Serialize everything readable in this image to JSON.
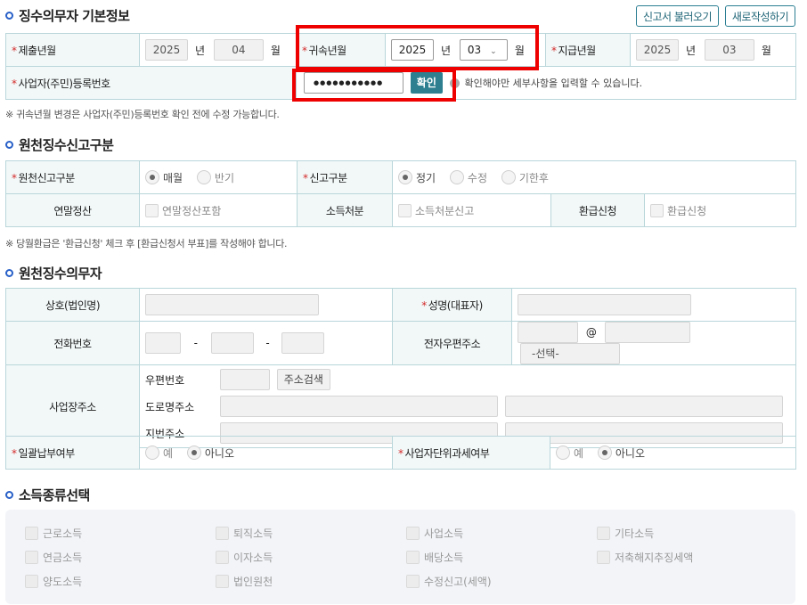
{
  "header": {
    "title": "징수의무자 기본정보",
    "btn_load": "신고서 불러오기",
    "btn_new": "새로작성하기"
  },
  "basic": {
    "submit_label": "제출년월",
    "submit_year": "2025",
    "submit_month": "04",
    "attribution_label": "귀속년월",
    "attribution_year": "2025",
    "attribution_month": "03",
    "payment_label": "지급년월",
    "payment_year": "2025",
    "payment_month": "03",
    "unit_year": "년",
    "unit_month": "월",
    "reg_no_label": "사업자(주민)등록번호",
    "reg_no_value": "●●●●●●●●●●●",
    "confirm_btn": "확인",
    "confirm_hint": "확인해야만 세부사항을 입력할 수 있습니다.",
    "note": "※ 귀속년월 변경은 사업자(주민)등록번호 확인 전에 수정 가능합니다."
  },
  "report_type": {
    "title": "원천징수신고구분",
    "withholding_label": "원천신고구분",
    "opt_monthly": "매월",
    "opt_half": "반기",
    "report_label": "신고구분",
    "opt_regular": "정기",
    "opt_amend": "수정",
    "opt_late": "기한후",
    "year_end_label": "연말정산",
    "year_end_chk": "연말정산포함",
    "disposal_label": "소득처분",
    "disposal_chk": "소득처분신고",
    "refund_label": "환급신청",
    "refund_chk": "환급신청",
    "note": "※ 당월환급은 '환급신청' 체크 후 [환급신청서 부표]를 작성해야 합니다."
  },
  "agent": {
    "title": "원천징수의무자",
    "company_label": "상호(법인명)",
    "ceo_label": "성명(대표자)",
    "phone_label": "전화번호",
    "email_label": "전자우편주소",
    "email_at": "@",
    "email_select": "-선택-",
    "dash": "-",
    "addr_label": "사업장주소",
    "zip_label": "우편번호",
    "zip_btn": "주소검색",
    "road_label": "도로명주소",
    "lot_label": "지번주소",
    "lump_label": "일괄납부여부",
    "unit_tax_label": "사업자단위과세여부",
    "opt_yes": "예",
    "opt_no": "아니오"
  },
  "income": {
    "title": "소득종류선택",
    "items": [
      "근로소득",
      "퇴직소득",
      "사업소득",
      "기타소득",
      "연금소득",
      "이자소득",
      "배당소득",
      "저축해지추징세액",
      "양도소득",
      "법인원천",
      "수정신고(세액)"
    ]
  }
}
